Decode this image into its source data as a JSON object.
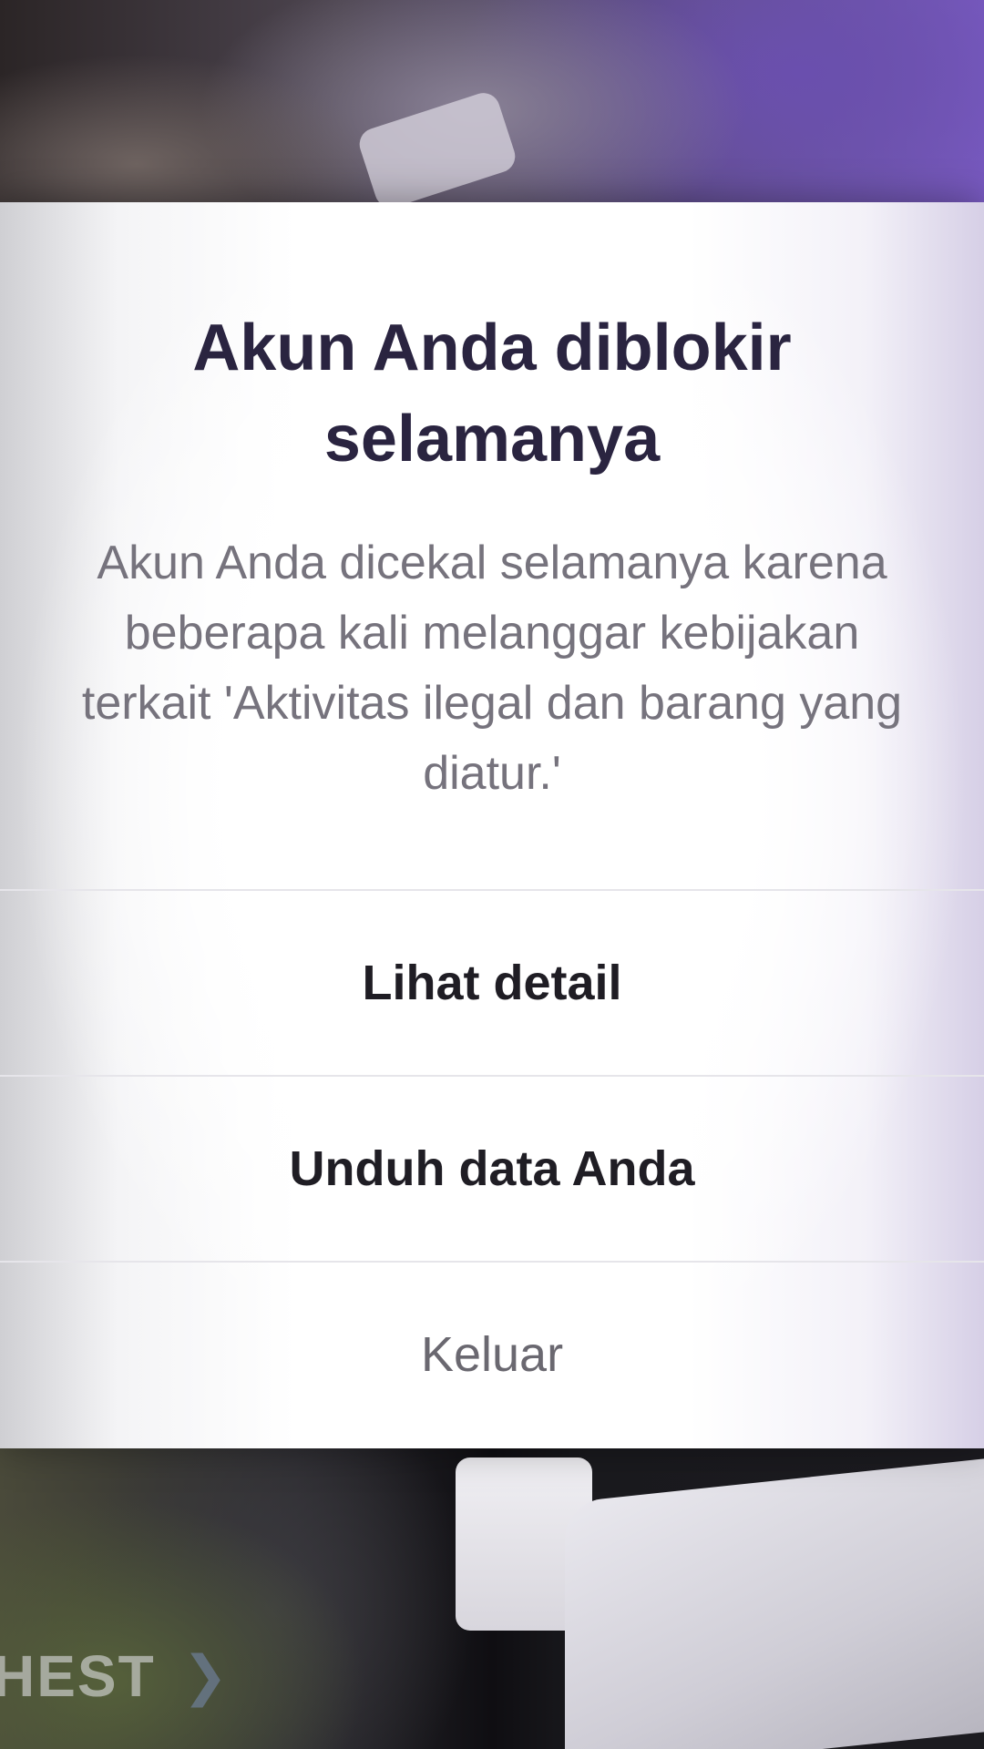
{
  "background": {
    "watermark_text": "HEST",
    "accent_color": "#7b5cc4"
  },
  "dialog": {
    "title": "Akun Anda diblokir selamanya",
    "message": "Akun Anda dicekal selamanya karena beberapa kali melanggar kebijakan terkait 'Aktivitas ilegal dan barang yang diatur.'",
    "actions": [
      {
        "label": "Lihat detail",
        "style": "bold"
      },
      {
        "label": "Unduh data Anda",
        "style": "bold"
      },
      {
        "label": "Keluar",
        "style": "regular"
      }
    ],
    "title_color": "#2a2440",
    "message_color": "#76737d"
  }
}
